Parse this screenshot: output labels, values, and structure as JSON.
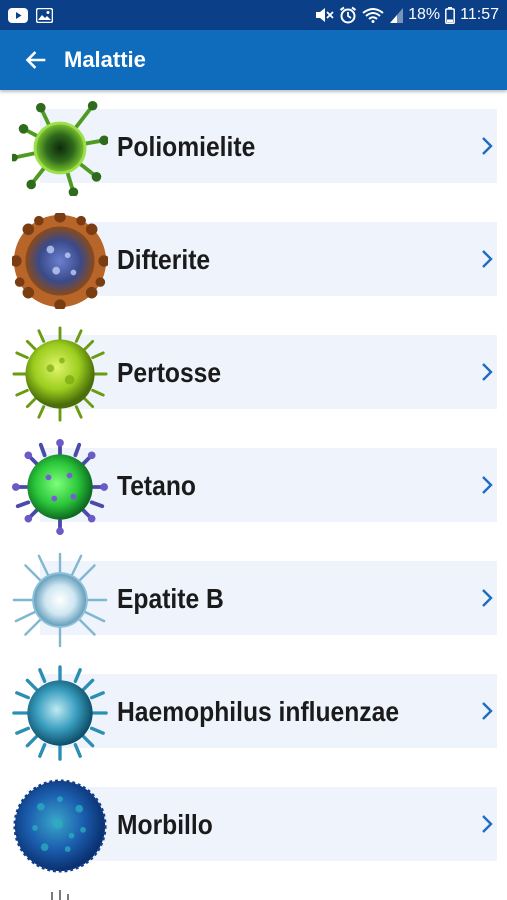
{
  "status_bar": {
    "left_icons": [
      "youtube-icon",
      "image-icon"
    ],
    "right_icons": [
      "mute-icon",
      "alarm-icon",
      "wifi-icon",
      "signal-icon",
      "battery-icon"
    ],
    "battery": "18%",
    "time": "11:57"
  },
  "app_bar": {
    "title": "Malattie",
    "back_icon": "back-arrow-icon"
  },
  "colors": {
    "status_bar": "#0b3f87",
    "app_bar": "#0f6cbd",
    "row_background": "#eef3fc",
    "chevron": "#1e6cc0"
  },
  "diseases": [
    {
      "label": "Poliomielite"
    },
    {
      "label": "Difterite"
    },
    {
      "label": "Pertosse"
    },
    {
      "label": "Tetano"
    },
    {
      "label": "Epatite B"
    },
    {
      "label": "Haemophilus influenzae"
    },
    {
      "label": "Morbillo"
    }
  ]
}
